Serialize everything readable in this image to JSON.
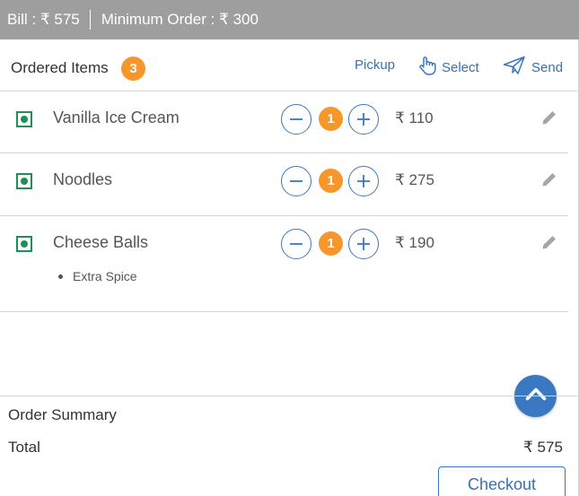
{
  "topbar": {
    "bill": "Bill : ₹ 575",
    "minimum_order": "Minimum Order : ₹ 300"
  },
  "header": {
    "title": "Ordered Items",
    "count": "3",
    "actions": {
      "pickup": "Pickup",
      "select": "Select",
      "send": "Send"
    }
  },
  "items": [
    {
      "name": "Vanilla Ice Cream",
      "qty": "1",
      "price": "₹ 110",
      "addons": []
    },
    {
      "name": "Noodles",
      "qty": "1",
      "price": "₹ 275",
      "addons": []
    },
    {
      "name": "Cheese Balls",
      "qty": "1",
      "price": "₹ 190",
      "addons": [
        "Extra Spice"
      ]
    }
  ],
  "summary": {
    "title": "Order Summary",
    "total_label": "Total",
    "total_value": "₹  575",
    "checkout_label": "Checkout"
  },
  "colors": {
    "topbar_bg": "#9e9e9e",
    "accent_blue": "#3a78c2",
    "badge_orange": "#f7962b",
    "veg_green": "#1e8f55"
  }
}
